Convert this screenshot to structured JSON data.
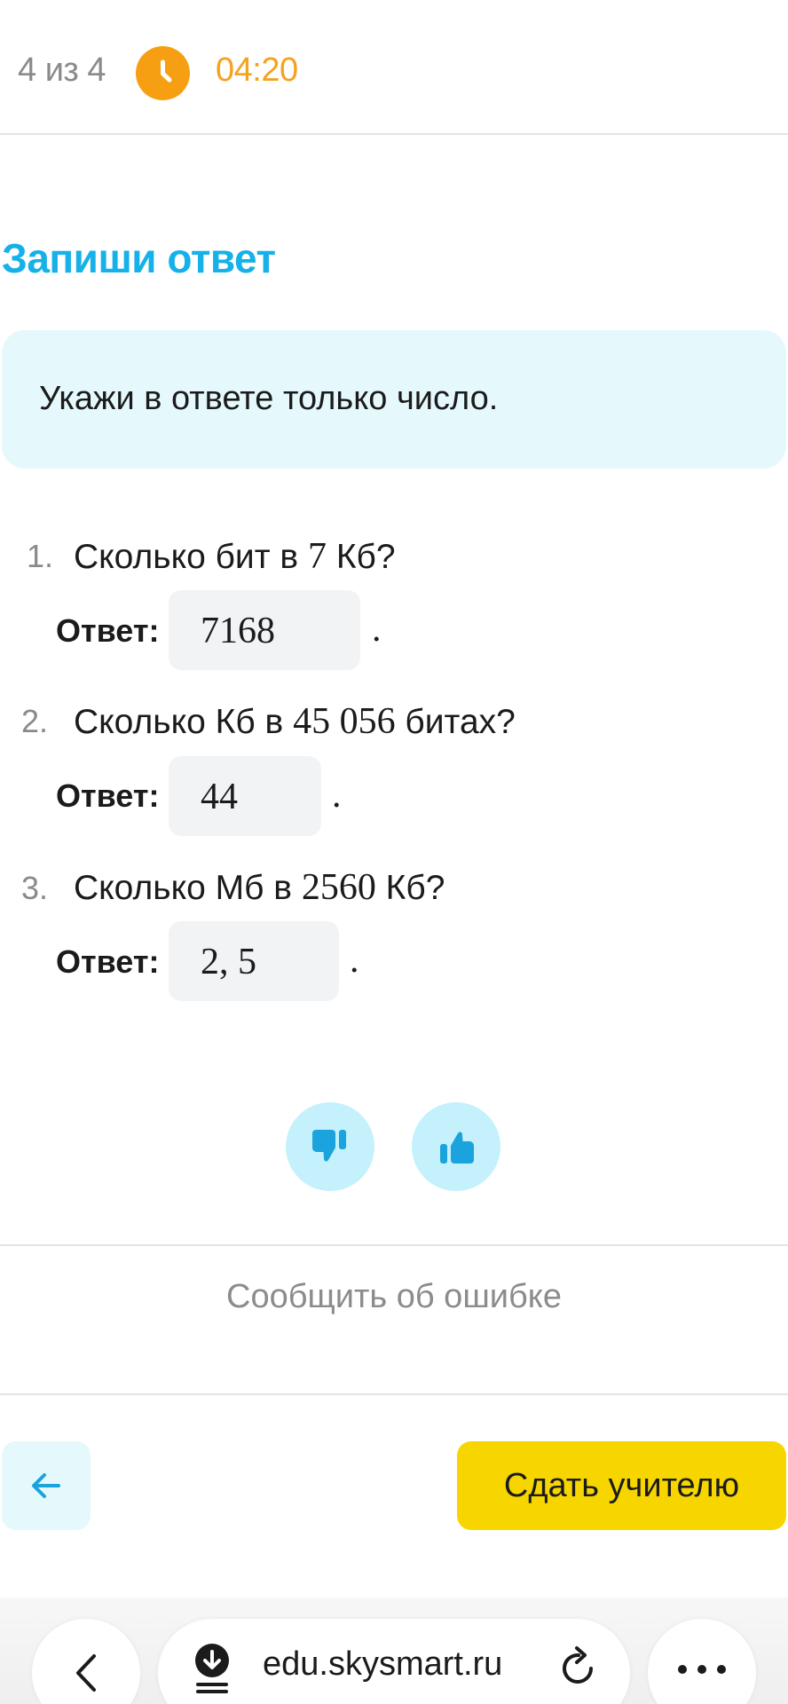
{
  "header": {
    "progress": "4 из 4",
    "timer": "04:20",
    "timer_icon": "clock-icon",
    "accent_color": "#f79f12"
  },
  "task": {
    "title": "Запиши ответ",
    "title_color": "#15b1e8",
    "hint": "Укажи в ответе только число."
  },
  "questions": [
    {
      "number": "1.",
      "before": "Сколько бит в",
      "math": "7",
      "after": "Кб?",
      "answer_label": "Ответ:",
      "answer": "7168"
    },
    {
      "number": "2.",
      "before": "Сколько Кб в",
      "math": "45 056",
      "after": "битах?",
      "answer_label": "Ответ:",
      "answer": "44"
    },
    {
      "number": "3.",
      "before": "Сколько Мб в",
      "math": "2560",
      "after": "Кб?",
      "answer_label": "Ответ:",
      "answer": "2, 5"
    }
  ],
  "answer_suffix": ".",
  "feedback": {
    "dislike_icon": "thumbs-down-icon",
    "like_icon": "thumbs-up-icon",
    "report_label": "Сообщить об ошибке"
  },
  "footer": {
    "back_icon": "arrow-left-icon",
    "submit_label": "Сдать учителю",
    "submit_color": "#f7d600"
  },
  "browser": {
    "url": "edu.skysmart.ru",
    "back_icon": "chevron-left-icon",
    "download_icon": "download-icon",
    "reload_icon": "reload-icon",
    "menu_icon": "more-icon"
  }
}
